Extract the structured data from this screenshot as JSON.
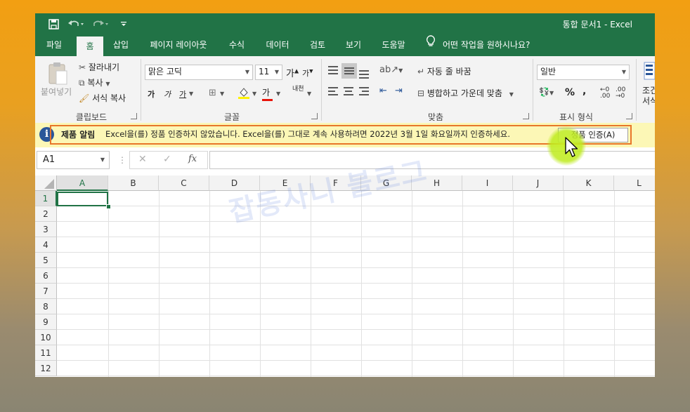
{
  "window": {
    "title": "통합 문서1  -  Excel"
  },
  "quick_access": {
    "save_icon": "save-icon",
    "undo_icon": "undo-icon",
    "redo_icon": "redo-icon",
    "customize_icon": "customize-qat-icon"
  },
  "tabs": [
    {
      "label": "파일"
    },
    {
      "label": "홈",
      "active": true
    },
    {
      "label": "삽입"
    },
    {
      "label": "페이지 레이아웃"
    },
    {
      "label": "수식"
    },
    {
      "label": "데이터"
    },
    {
      "label": "검토"
    },
    {
      "label": "보기"
    },
    {
      "label": "도움말"
    }
  ],
  "tell_me": {
    "label": "어떤 작업을 원하시나요?",
    "icon": "lightbulb-icon"
  },
  "ribbon": {
    "clipboard": {
      "paste_label": "붙여넣기",
      "cut_label": "잘라내기",
      "copy_label": "복사",
      "format_painter_label": "서식 복사",
      "group_label": "클립보드"
    },
    "font": {
      "font_name": "맑은 고딕",
      "font_size": "11",
      "bold": "가",
      "italic": "가",
      "underline": "가",
      "font_color_label": "가",
      "phonetic_label": "내천",
      "group_label": "글꼴"
    },
    "alignment": {
      "wrap_text_label": "자동 줄 바꿈",
      "merge_label": "병합하고 가운데 맞춤",
      "group_label": "맞춤"
    },
    "number": {
      "format_value": "일반",
      "percent": "%",
      "comma": ",",
      "group_label": "표시 형식"
    },
    "styles": {
      "cond_label_1": "조건",
      "cond_label_2": "서식"
    }
  },
  "notice": {
    "title": "제품 알림",
    "message": "Excel을(를) 정품 인증하지 않았습니다. Excel을(를) 그대로 계속 사용하려면 2022년 3월 1일 화요일까지 인증하세요.",
    "button_label": "정품 인증(A)"
  },
  "formula_bar": {
    "name_box": "A1",
    "formula": ""
  },
  "sheet": {
    "columns": [
      "A",
      "B",
      "C",
      "D",
      "E",
      "F",
      "G",
      "H",
      "I",
      "J",
      "K",
      "L"
    ],
    "rows": [
      "1",
      "2",
      "3",
      "4",
      "5",
      "6",
      "7",
      "8",
      "9",
      "10",
      "11",
      "12"
    ],
    "active_cell": "A1"
  },
  "watermark": "잡동사니 블로그",
  "colors": {
    "excel_green": "#217346",
    "notice_bg": "#fcf7b6",
    "highlight_border": "#e8762a"
  }
}
